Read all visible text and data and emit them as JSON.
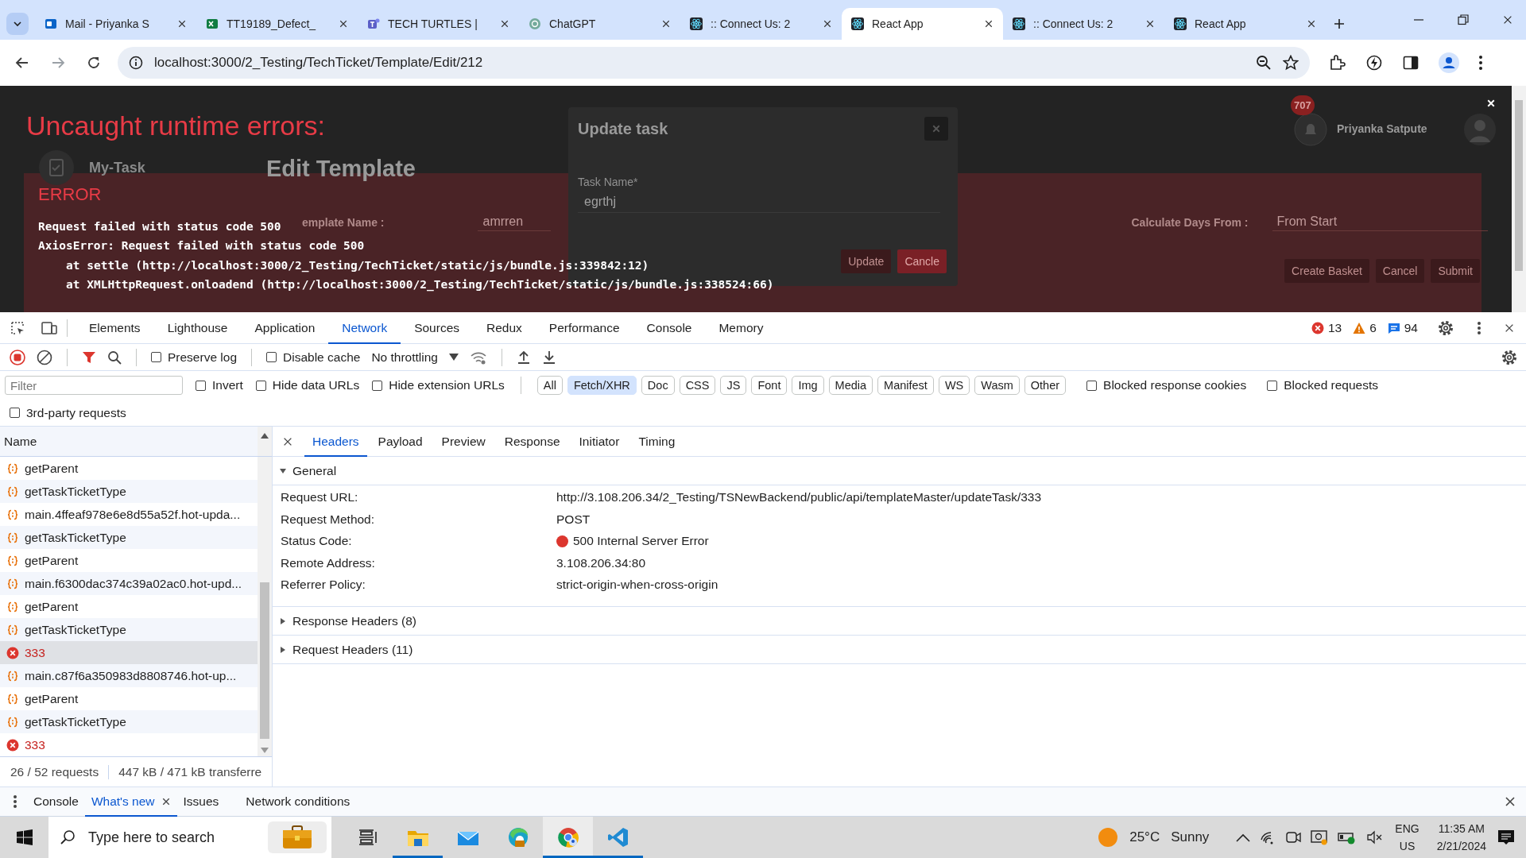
{
  "browser": {
    "tabs": [
      {
        "title": "Mail - Priyanka S",
        "kind": "outlook",
        "selected": false
      },
      {
        "title": "TT19189_Defect_",
        "kind": "excel",
        "selected": false
      },
      {
        "title": "TECH TURTLES | ",
        "kind": "teams",
        "selected": false
      },
      {
        "title": "ChatGPT",
        "kind": "chatgpt",
        "selected": false
      },
      {
        "title": ":: Connect Us: 2",
        "kind": "react",
        "selected": false
      },
      {
        "title": "React App",
        "kind": "react",
        "selected": true
      },
      {
        "title": ":: Connect Us: 2",
        "kind": "react",
        "selected": false
      },
      {
        "title": "React App",
        "kind": "react",
        "selected": false
      }
    ],
    "address": "localhost:3000/2_Testing/TechTicket/Template/Edit/212"
  },
  "page": {
    "sidebar_title": "My-Task",
    "heading": "Edit Template",
    "notification_count": "707",
    "user_name": "Priyanka Satpute",
    "template_label": "emplate Name :",
    "template_value": "amrren",
    "calc_label": "Calculate Days From :",
    "calc_value": "From Start",
    "buttons": [
      {
        "label": "Create Basket",
        "kind": "dark"
      },
      {
        "label": "Cancel",
        "kind": "dark"
      },
      {
        "label": "Submit",
        "kind": "dark"
      }
    ],
    "modal": {
      "title": "Update task",
      "field_label": "Task Name*",
      "field_value": "egrthj",
      "buttons": [
        {
          "label": "Update",
          "kind": "dark"
        },
        {
          "label": "Cancle",
          "kind": "danger"
        }
      ]
    }
  },
  "error_overlay": {
    "title": "Uncaught runtime errors:",
    "label": "ERROR",
    "lines": [
      {
        "text": "Request failed with status code 500",
        "kind": "message"
      },
      {
        "text": "AxiosError: Request failed with status code 500",
        "kind": "message"
      },
      {
        "text": "at settle (http://localhost:3000/2_Testing/TechTicket/static/js/bundle.js:339842:12)",
        "kind": "frame"
      },
      {
        "text": "at XMLHttpRequest.onloadend (http://localhost:3000/2_Testing/TechTicket/static/js/bundle.js:338524:66)",
        "kind": "frame"
      }
    ]
  },
  "devtools": {
    "tabs": [
      {
        "label": "Elements",
        "selected": false
      },
      {
        "label": "Lighthouse",
        "selected": false
      },
      {
        "label": "Application",
        "selected": false
      },
      {
        "label": "Network",
        "selected": true
      },
      {
        "label": "Sources",
        "selected": false
      },
      {
        "label": "Redux",
        "selected": false
      },
      {
        "label": "Performance",
        "selected": false
      },
      {
        "label": "Console",
        "selected": false
      },
      {
        "label": "Memory",
        "selected": false
      }
    ],
    "errors": "13",
    "warnings": "6",
    "messages": "94",
    "preserve_log": {
      "label": "Preserve log",
      "checked": false
    },
    "disable_cache": {
      "label": "Disable cache",
      "checked": false
    },
    "throttling": "No throttling",
    "filter": {
      "placeholder": "Filter",
      "options": [
        {
          "label": "Invert",
          "checked": false
        },
        {
          "label": "Hide data URLs",
          "checked": false
        },
        {
          "label": "Hide extension URLs",
          "checked": false
        }
      ],
      "types": [
        {
          "label": "All",
          "selected": false
        },
        {
          "label": "Fetch/XHR",
          "selected": true
        },
        {
          "label": "Doc",
          "selected": false
        },
        {
          "label": "CSS",
          "selected": false
        },
        {
          "label": "JS",
          "selected": false
        },
        {
          "label": "Font",
          "selected": false
        },
        {
          "label": "Img",
          "selected": false
        },
        {
          "label": "Media",
          "selected": false
        },
        {
          "label": "Manifest",
          "selected": false
        },
        {
          "label": "WS",
          "selected": false
        },
        {
          "label": "Wasm",
          "selected": false
        },
        {
          "label": "Other",
          "selected": false
        }
      ],
      "blocked": [
        {
          "label": "Blocked response cookies",
          "checked": false
        },
        {
          "label": "Blocked requests",
          "checked": false
        }
      ],
      "third_party": {
        "label": "3rd-party requests",
        "checked": false
      }
    },
    "requests": {
      "column": "Name",
      "rows": [
        {
          "name": "getParent",
          "failed": false,
          "selected": false
        },
        {
          "name": "getTaskTicketType",
          "failed": false,
          "selected": false
        },
        {
          "name": "main.4ffeaf978e6e8d55a52f.hot-upda...",
          "failed": false,
          "selected": false
        },
        {
          "name": "getTaskTicketType",
          "failed": false,
          "selected": false
        },
        {
          "name": "getParent",
          "failed": false,
          "selected": false
        },
        {
          "name": "main.f6300dac374c39a02ac0.hot-upd...",
          "failed": false,
          "selected": false
        },
        {
          "name": "getParent",
          "failed": false,
          "selected": false
        },
        {
          "name": "getTaskTicketType",
          "failed": false,
          "selected": false
        },
        {
          "name": "333",
          "failed": true,
          "selected": true
        },
        {
          "name": "main.c87f6a350983d8808746.hot-up...",
          "failed": false,
          "selected": false
        },
        {
          "name": "getParent",
          "failed": false,
          "selected": false
        },
        {
          "name": "getTaskTicketType",
          "failed": false,
          "selected": false
        },
        {
          "name": "333",
          "failed": true,
          "selected": false
        }
      ]
    },
    "summary": {
      "requests": "26 / 52 requests",
      "transferred": "447 kB / 471 kB transferre"
    },
    "detail_tabs": [
      {
        "label": "Headers",
        "selected": true
      },
      {
        "label": "Payload",
        "selected": false
      },
      {
        "label": "Preview",
        "selected": false
      },
      {
        "label": "Response",
        "selected": false
      },
      {
        "label": "Initiator",
        "selected": false
      },
      {
        "label": "Timing",
        "selected": false
      }
    ],
    "sections": [
      {
        "title": "General",
        "expanded": true,
        "rows": [
          {
            "label": "Request URL:",
            "value": "http://3.108.206.34/2_Testing/TSNewBackend/public/api/templateMaster/updateTask/333",
            "kind": "text"
          },
          {
            "label": "Request Method:",
            "value": "POST",
            "kind": "text"
          },
          {
            "label": "Status Code:",
            "value": "500 Internal Server Error",
            "kind": "status",
            "color": "#dc362e"
          },
          {
            "label": "Remote Address:",
            "value": "3.108.206.34:80",
            "kind": "text"
          },
          {
            "label": "Referrer Policy:",
            "value": "strict-origin-when-cross-origin",
            "kind": "text"
          }
        ]
      },
      {
        "title": "Response Headers (8)",
        "expanded": false
      },
      {
        "title": "Request Headers (11)",
        "expanded": false
      }
    ],
    "drawer_tabs": [
      {
        "label": "Console",
        "selected": false,
        "closable": false
      },
      {
        "label": "What's new",
        "selected": true,
        "closable": true
      },
      {
        "label": "Issues",
        "selected": false,
        "closable": false
      },
      {
        "label": "Network conditions",
        "selected": false,
        "closable": false
      }
    ]
  },
  "taskbar": {
    "search_placeholder": "Type here to search",
    "apps": [
      {
        "kind": "task-view",
        "running": false,
        "active": false
      },
      {
        "kind": "folder",
        "running": true,
        "active": false
      },
      {
        "kind": "mail",
        "running": false,
        "active": false
      },
      {
        "kind": "edge",
        "running": false,
        "active": false
      },
      {
        "kind": "chrome",
        "running": true,
        "active": true
      },
      {
        "kind": "vscode",
        "running": true,
        "active": false
      }
    ],
    "temperature": "25°C",
    "weather": "Sunny",
    "language": "ENG",
    "region": "US",
    "time": "11:35 AM",
    "date": "2/21/2024"
  }
}
